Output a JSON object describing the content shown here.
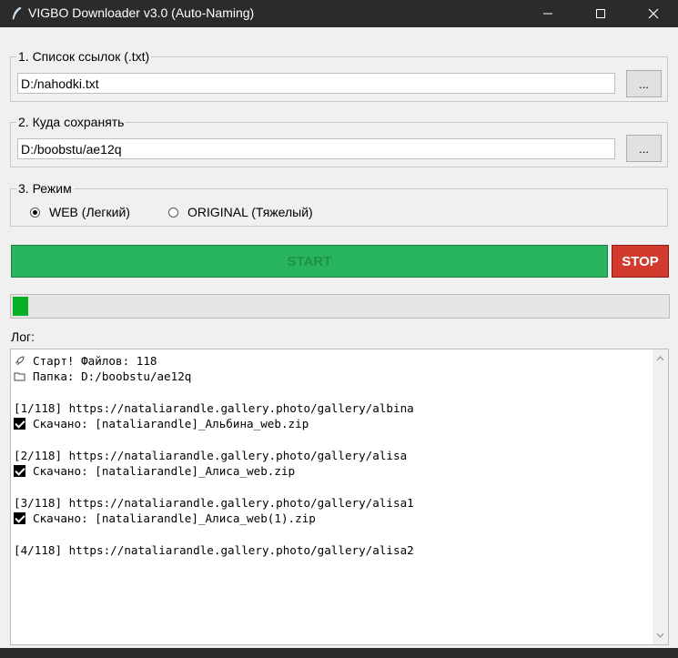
{
  "window": {
    "title": "VIGBO Downloader v3.0 (Auto-Naming)",
    "icons": [
      "feather-app-icon",
      "minimize-icon",
      "maximize-icon",
      "close-icon"
    ]
  },
  "links_group": {
    "legend": "1. Список ссылок (.txt)",
    "value": "D:/nahodki.txt",
    "browse_label": "..."
  },
  "save_group": {
    "legend": "2. Куда сохранять",
    "value": "D:/boobstu/ae12q",
    "browse_label": "..."
  },
  "mode_group": {
    "legend": "3. Режим",
    "options": [
      {
        "label": "WEB (Легкий)",
        "selected": true
      },
      {
        "label": "ORIGINAL (Тяжелый)",
        "selected": false
      }
    ]
  },
  "actions": {
    "start_label": "START",
    "stop_label": "STOP"
  },
  "progress": {
    "fraction": 0.0085,
    "fill_color": "#06b025"
  },
  "log": {
    "label": "Лог:",
    "lines": [
      {
        "icon": "rocket-icon",
        "text": "Старт! Файлов: 118"
      },
      {
        "icon": "folder-icon",
        "text": "Папка: D:/boobstu/ae12q"
      },
      {
        "icon": "",
        "text": ""
      },
      {
        "icon": "",
        "text": "[1/118] https://nataliarandle.gallery.photo/gallery/albina"
      },
      {
        "icon": "check-icon",
        "text": "Скачано: [nataliarandle]_Альбина_web.zip"
      },
      {
        "icon": "",
        "text": ""
      },
      {
        "icon": "",
        "text": "[2/118] https://nataliarandle.gallery.photo/gallery/alisa"
      },
      {
        "icon": "check-icon",
        "text": "Скачано: [nataliarandle]_Алиса_web.zip"
      },
      {
        "icon": "",
        "text": ""
      },
      {
        "icon": "",
        "text": "[3/118] https://nataliarandle.gallery.photo/gallery/alisa1"
      },
      {
        "icon": "check-icon",
        "text": "Скачано: [nataliarandle]_Алиса_web(1).zip"
      },
      {
        "icon": "",
        "text": ""
      },
      {
        "icon": "",
        "text": "[4/118] https://nataliarandle.gallery.photo/gallery/alisa2"
      }
    ]
  },
  "colors": {
    "start": "#29b45e",
    "stop": "#d23a2e",
    "titlebar": "#2b2b2b"
  }
}
